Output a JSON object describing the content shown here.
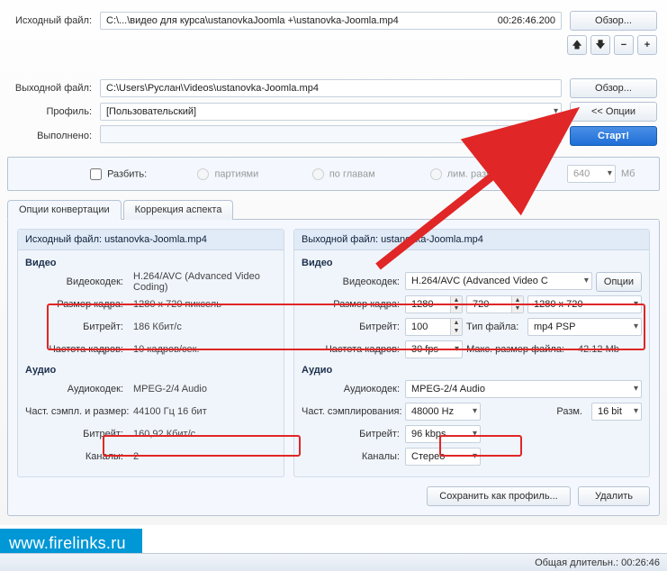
{
  "top": {
    "source_label": "Исходный файл:",
    "source_path": "C:\\...\\видео для курса\\ustanovkaJoomla +\\ustanovka-Joomla.mp4",
    "source_duration": "00:26:46.200",
    "output_label": "Выходной файл:",
    "output_path": "C:\\Users\\Руслан\\Videos\\ustanovka-Joomla.mp4",
    "profile_label": "Профиль:",
    "profile_value": "[Пользовательский]",
    "done_label": "Выполнено:"
  },
  "buttons": {
    "browse": "Обзор...",
    "options": "<< Опции",
    "start": "Старт!"
  },
  "split": {
    "split_label": "Разбить:",
    "by_batches": "партиями",
    "by_chapters": "по главам",
    "by_size": "лим. размер",
    "size_value": "640",
    "size_unit": "Мб"
  },
  "tabs": {
    "conv": "Опции конвертации",
    "aspect": "Коррекция аспекта"
  },
  "src": {
    "title_label": "Исходный файл:",
    "title_value": "ustanovka-Joomla.mp4",
    "video_heading": "Видео",
    "audio_heading": "Аудио",
    "vcodec_label": "Видеокодек:",
    "vcodec": "H.264/AVC (Advanced Video Coding)",
    "framesize_label": "Размер кадра:",
    "framesize": "1280 x 720 пиксель",
    "bitrate_label": "Битрейт:",
    "bitrate": "186 Кбит/с",
    "framerate_label": "Частота кадров:",
    "framerate": "10 кадров/сек.",
    "acodec_label": "Аудиокодек:",
    "acodec": "MPEG-2/4 Audio",
    "sample_label": "Част. сэмпл. и размер:",
    "sample": "44100 Гц 16 бит",
    "abitrate_label": "Битрейт:",
    "abitrate": "160,92 Кбит/с",
    "channels_label": "Каналы:",
    "channels": "2"
  },
  "dst": {
    "title_label": "Выходной файл:",
    "title_value": "ustanovka-Joomla.mp4",
    "video_heading": "Видео",
    "audio_heading": "Аудио",
    "vcodec_label": "Видеокодек:",
    "vcodec": "H.264/AVC (Advanced Video C",
    "opts_btn": "Опции",
    "framesize_label": "Размер кадра:",
    "width": "1280",
    "height": "720",
    "preset": "1280 x 720",
    "bitrate_label": "Битрейт:",
    "bitrate": "100",
    "filetype_label": "Тип файла:",
    "filetype": "mp4 PSP",
    "framerate_label": "Частота кадров:",
    "framerate": "30 fps",
    "maxsize_label": "Макс. размер файла:",
    "maxsize": "42.12 Mb",
    "acodec_label": "Аудиокодек:",
    "acodec": "MPEG-2/4 Audio",
    "sample_label": "Част. сэмплирования:",
    "sample": "48000 Hz",
    "bits_label": "Разм.",
    "bits": "16 bit",
    "abitrate_label": "Битрейт:",
    "abitrate": "96 kbps",
    "channels_label": "Каналы:",
    "channels": "Стерео"
  },
  "bottom": {
    "save_profile": "Сохранить как профиль...",
    "delete": "Удалить"
  },
  "statusbar": {
    "total_label": "Общая длительн.:",
    "total_value": "00:26:46"
  },
  "watermark": "www.firelinks.ru"
}
